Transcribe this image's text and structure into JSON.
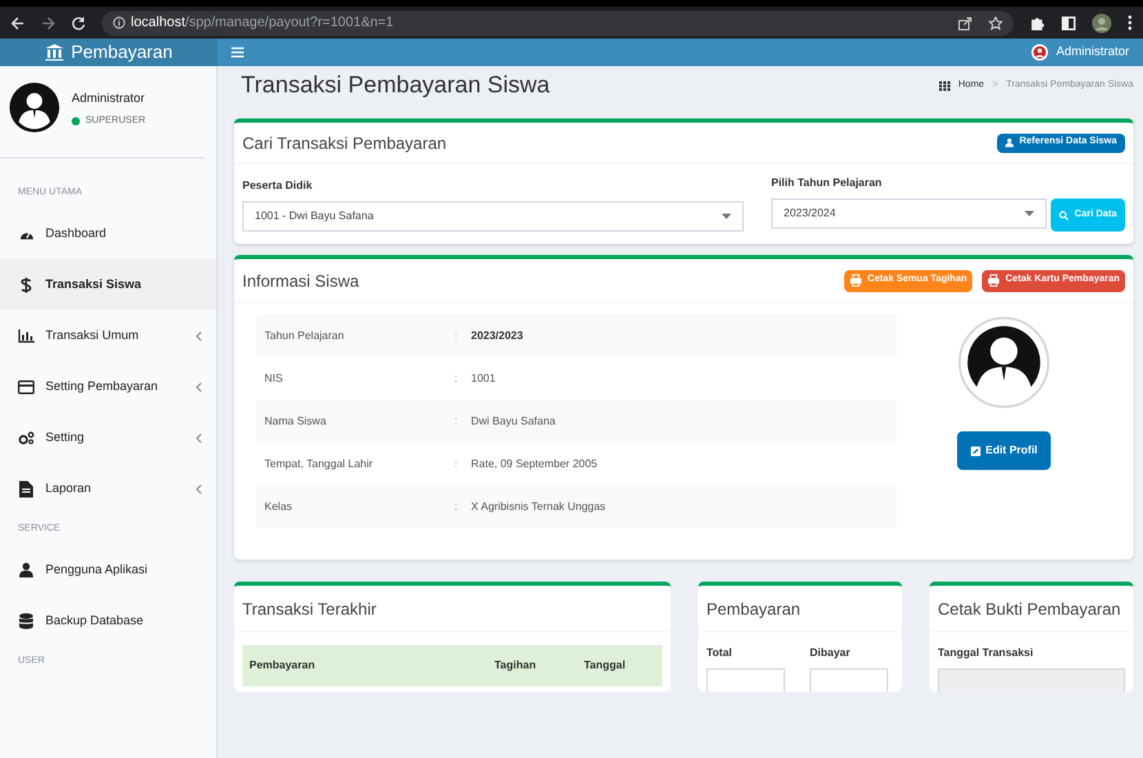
{
  "browser": {
    "url_host": "localhost",
    "url_path": "/spp/manage/payout?r=1001&n=1"
  },
  "header": {
    "brand": "Pembayaran",
    "user": "Administrator"
  },
  "sidebar": {
    "user": {
      "name": "Administrator",
      "status": "SUPERUSER"
    },
    "sections": [
      {
        "label": "MENU UTAMA",
        "items": [
          {
            "label": "Dashboard",
            "selected": false,
            "expandable": false
          },
          {
            "label": "Transaksi Siswa",
            "selected": true,
            "expandable": false
          },
          {
            "label": "Transaksi Umum",
            "selected": false,
            "expandable": true
          },
          {
            "label": "Setting Pembayaran",
            "selected": false,
            "expandable": true
          },
          {
            "label": "Setting",
            "selected": false,
            "expandable": true
          },
          {
            "label": "Laporan",
            "selected": false,
            "expandable": true
          }
        ]
      },
      {
        "label": "SERVICE",
        "items": [
          {
            "label": "Pengguna Aplikasi",
            "selected": false,
            "expandable": false
          },
          {
            "label": "Backup Database",
            "selected": false,
            "expandable": false
          }
        ]
      },
      {
        "label": "USER"
      }
    ]
  },
  "page": {
    "title": "Transaksi Pembayaran Siswa",
    "breadcrumb": [
      "Home",
      ">",
      "Transaksi Pembayaran Siswa"
    ]
  },
  "search_card": {
    "title": "Cari Transaksi Pembayaran",
    "button": "Referensi Data Siswa",
    "fields": [
      {
        "label": "Peserta Didik",
        "value": "1001 - Dwi Bayu Safana"
      },
      {
        "label": "Pilih Tahun Pelajaran",
        "value": "2023/2024"
      }
    ],
    "search_button": "Cari Data"
  },
  "info_card": {
    "title": "Informasi Siswa",
    "buttons": [
      {
        "label": "Cetak Semua Tagihan",
        "color": "#ff851b"
      },
      {
        "label": "Cetak Kartu Pembayaran",
        "color": "#dd4b39"
      }
    ],
    "rows": [
      {
        "label": "Tahun Pelajaran",
        "colon": ":",
        "value": "2023/2023",
        "bold": true
      },
      {
        "label": "NIS",
        "colon": ":",
        "value": "1001",
        "bold": false
      },
      {
        "label": "Nama Siswa",
        "colon": ":",
        "value": "Dwi Bayu Safana",
        "bold": false
      },
      {
        "label": "Tempat, Tanggal Lahir",
        "colon": ":",
        "value": "Rate, 09 September 2005",
        "bold": false
      },
      {
        "label": "Kelas",
        "colon": ":",
        "value": "X Agribisnis Ternak Unggas",
        "bold": false
      }
    ],
    "edit_button": "Edit Profil"
  },
  "recent_card": {
    "title": "Transaksi Terakhir",
    "columns": [
      "Pembayaran",
      "Tagihan",
      "Tanggal"
    ]
  },
  "payment_card": {
    "title": "Pembayaran",
    "fields": [
      "Total",
      "Dibayar"
    ]
  },
  "receipt_card": {
    "title": "Cetak Bukti Pembayaran",
    "fields": [
      "Tanggal Transaksi"
    ]
  }
}
